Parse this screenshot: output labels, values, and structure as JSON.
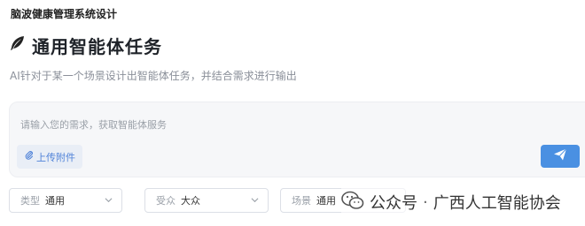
{
  "app": {
    "title": "脑波健康管理系统设计"
  },
  "page": {
    "heading": "通用智能体任务",
    "subtitle": "AI针对于某一个场景设计出智能体任务，并结合需求进行输出",
    "heading_icon": "feather-icon"
  },
  "composer": {
    "placeholder": "请输入您的需求，获取智能体服务",
    "upload_label": "上传附件",
    "send_icon": "send-icon"
  },
  "filters": [
    {
      "label": "类型",
      "value": "通用"
    },
    {
      "label": "受众",
      "value": "大众"
    },
    {
      "label": "场景",
      "value": "通用"
    }
  ],
  "watermark": {
    "prefix": "公众号",
    "separator": "·",
    "name": "广西人工智能协会"
  },
  "colors": {
    "accent": "#4a90e2",
    "upload_text": "#4f82d8",
    "panel_bg": "#f6f7f9"
  }
}
